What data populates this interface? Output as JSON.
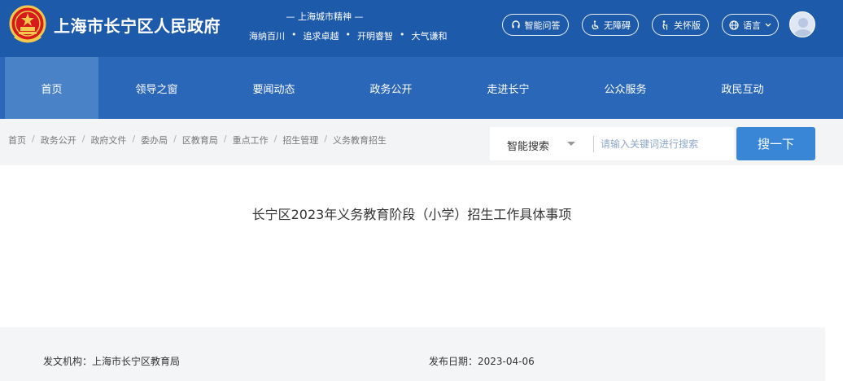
{
  "header": {
    "site_title": "上海市长宁区人民政府",
    "spirit_title": "— 上海城市精神 —",
    "spirit_items": [
      "海纳百川",
      "追求卓越",
      "开明睿智",
      "大气谦和"
    ],
    "spirit_separator": "•",
    "buttons": {
      "smart_qa": "智能问答",
      "accessibility": "无障碍",
      "elder_mode": "关怀版",
      "language": "语言"
    },
    "colors": {
      "header_bg": "#1e5aaa",
      "nav_bg": "#2a67b9",
      "nav_active": "#4a82c7"
    }
  },
  "nav": {
    "items": [
      {
        "label": "首页",
        "active": true
      },
      {
        "label": "领导之窗",
        "active": false
      },
      {
        "label": "要闻动态",
        "active": false
      },
      {
        "label": "政务公开",
        "active": false
      },
      {
        "label": "走进长宁",
        "active": false
      },
      {
        "label": "公众服务",
        "active": false
      },
      {
        "label": "政民互动",
        "active": false
      }
    ]
  },
  "breadcrumb": {
    "items": [
      "首页",
      "政务公开",
      "政府文件",
      "委办局",
      "区教育局",
      "重点工作",
      "招生管理",
      "义务教育招生"
    ],
    "separator": "/"
  },
  "search": {
    "scope_label": "智能搜索",
    "placeholder": "请输入关键词进行搜索",
    "button_label": "搜一下",
    "button_color": "#3a86d6"
  },
  "document": {
    "title": "长宁区2023年义务教育阶段（小学）招生工作具体事项",
    "issuer_label": "发文机构：",
    "issuer": "上海市长宁区教育局",
    "date_label": "发布日期：",
    "date": "2023-04-06"
  }
}
